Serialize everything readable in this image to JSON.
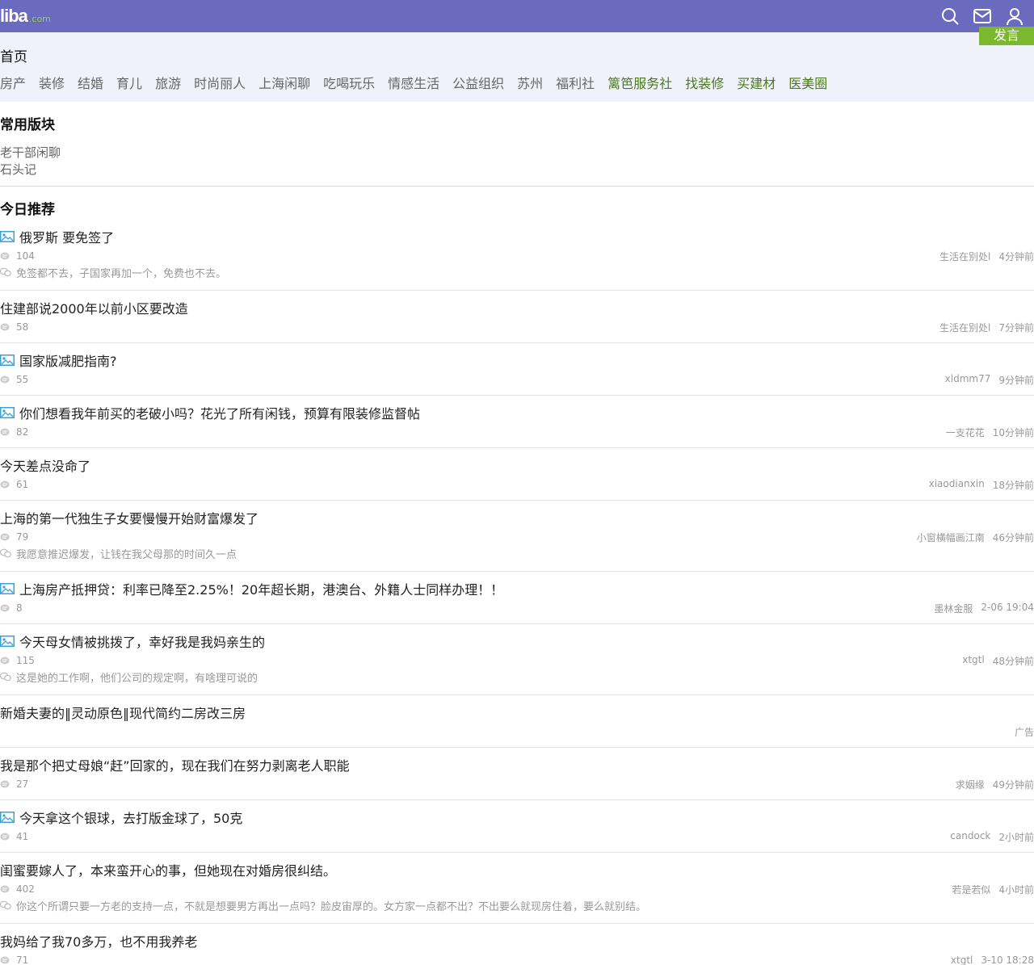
{
  "header": {
    "logo_main": "liba",
    "logo_sub": ".com",
    "icons": [
      "search-icon",
      "mail-icon",
      "user-icon"
    ]
  },
  "nav": {
    "home": "首页",
    "post_button": "发言",
    "links": [
      {
        "label": "房产",
        "green": false
      },
      {
        "label": "装修",
        "green": false
      },
      {
        "label": "结婚",
        "green": false
      },
      {
        "label": "育儿",
        "green": false
      },
      {
        "label": "旅游",
        "green": false
      },
      {
        "label": "时尚丽人",
        "green": false
      },
      {
        "label": "上海闲聊",
        "green": false
      },
      {
        "label": "吃喝玩乐",
        "green": false
      },
      {
        "label": "情感生活",
        "green": false
      },
      {
        "label": "公益组织",
        "green": false
      },
      {
        "label": "苏州",
        "green": false
      },
      {
        "label": "福利社",
        "green": false
      },
      {
        "label": "篱笆服务社",
        "green": true
      },
      {
        "label": "找装修",
        "green": true
      },
      {
        "label": "买建材",
        "green": true
      },
      {
        "label": "医美圈",
        "green": true
      }
    ]
  },
  "frequent": {
    "title": "常用版块",
    "items": [
      "老干部闲聊",
      "石头记"
    ]
  },
  "today": {
    "title": "今日推荐",
    "posts": [
      {
        "title": "俄罗斯 要免签了",
        "has_image": true,
        "count": "104",
        "author": "生活在别处l",
        "time": "4分钟前",
        "reply": "免签都不去，子国家再加一个，免费也不去。"
      },
      {
        "title": "住建部说2000年以前小区要改造",
        "has_image": false,
        "count": "58",
        "author": "生活在别处l",
        "time": "7分钟前",
        "reply": ""
      },
      {
        "title": "国家版减肥指南?",
        "has_image": true,
        "count": "55",
        "author": "xldmm77",
        "time": "9分钟前",
        "reply": ""
      },
      {
        "title": "你们想看我年前买的老破小吗？花光了所有闲钱，预算有限装修监督帖",
        "has_image": true,
        "count": "82",
        "author": "一支花花",
        "time": "10分钟前",
        "reply": ""
      },
      {
        "title": "今天差点没命了",
        "has_image": false,
        "count": "61",
        "author": "xiaodianxin",
        "time": "18分钟前",
        "reply": ""
      },
      {
        "title": "上海的第一代独生子女要慢慢开始财富爆发了",
        "has_image": false,
        "count": "79",
        "author": "小窗横幅画江南",
        "time": "46分钟前",
        "reply": "我愿意推迟爆发，让钱在我父母那的时间久一点"
      },
      {
        "title": "上海房产抵押贷：利率已降至2.25%！20年超长期，港澳台、外籍人士同样办理！！",
        "has_image": true,
        "count": "8",
        "author": "墨林金服",
        "time": "2-06 19:04",
        "reply": ""
      },
      {
        "title": "今天母女情被挑拨了，幸好我是我妈亲生的",
        "has_image": true,
        "count": "115",
        "author": "xtgtl",
        "time": "48分钟前",
        "reply": "这是她的工作啊，他们公司的规定啊，有啥理可说的"
      },
      {
        "title": "新婚夫妻的‖灵动原色‖现代简约二房改三房",
        "has_image": false,
        "count": "",
        "author": "",
        "time": "广告",
        "reply": ""
      },
      {
        "title": "我是那个把丈母娘“赶”回家的，现在我们在努力剥离老人职能",
        "has_image": false,
        "count": "27",
        "author": "求姻缘",
        "time": "49分钟前",
        "reply": ""
      },
      {
        "title": "今天拿这个银球，去打版金球了，50克",
        "has_image": true,
        "count": "41",
        "author": "candock",
        "time": "2小时前",
        "reply": ""
      },
      {
        "title": "闺蜜要嫁人了，本来蛮开心的事，但她现在对婚房很纠结。",
        "has_image": false,
        "count": "402",
        "author": "若是若似",
        "time": "4小时前",
        "reply": "你这个所谓只要一方老的支持一点，不就是想要男方再出一点吗？脸皮宙厚的。女方家一点都不出？不出要么就现房住着，要么就别结。"
      },
      {
        "title": "我妈给了我70多万，也不用我养老",
        "has_image": false,
        "count": "71",
        "author": "xtgtl",
        "time": "3-10 18:28",
        "reply": ""
      }
    ]
  }
}
